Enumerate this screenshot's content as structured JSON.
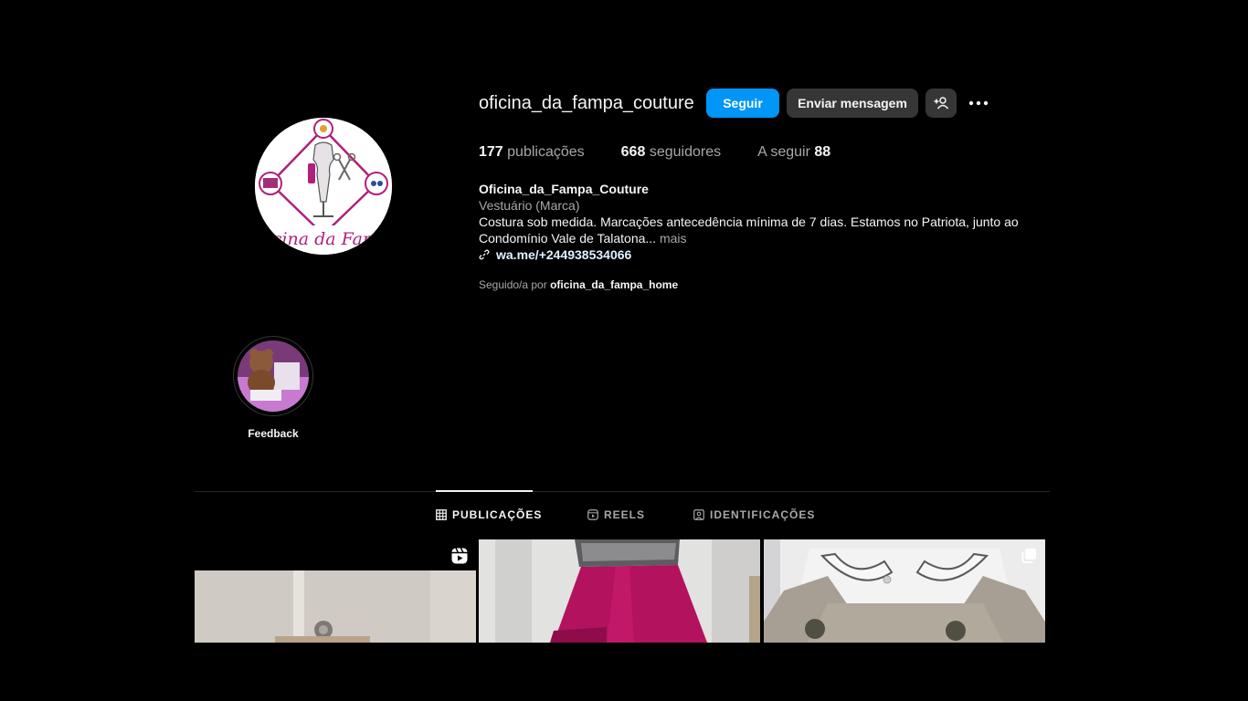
{
  "profile": {
    "username": "oficina_da_fampa_couture",
    "avatar_icon": "profile-logo-oficina",
    "avatar_text": "Oficina da Fampa"
  },
  "actions": {
    "follow_label": "Seguir",
    "message_label": "Enviar mensagem",
    "add_user_icon": "add-user-icon",
    "more_icon": "more-options-icon"
  },
  "stats": {
    "posts_count": "177",
    "posts_label": "publicações",
    "followers_count": "668",
    "followers_label": "seguidores",
    "following_label": "A seguir",
    "following_count": "88"
  },
  "bio": {
    "name": "Oficina_da_Fampa_Couture",
    "category": "Vestuário (Marca)",
    "description": "Costura sob medida. Marcações antecedência mínima de 7 dias. Estamos no Patriota, junto ao Condomínio Vale de Talatona...",
    "more_label": "mais",
    "link_icon": "link-icon",
    "link": "wa.me/+244938534066",
    "followed_by_prefix": "Seguido/a por",
    "followed_by_user": "oficina_da_fampa_home"
  },
  "highlights": [
    {
      "label": "Feedback"
    }
  ],
  "tabs": [
    {
      "label": "PUBLICAÇÕES",
      "icon": "grid-icon",
      "active": true
    },
    {
      "label": "REELS",
      "icon": "reels-icon",
      "active": false
    },
    {
      "label": "IDENTIFICAÇÕES",
      "icon": "tagged-icon",
      "active": false
    }
  ],
  "posts": [
    {
      "type": "reel",
      "overlay_icon": "reels-icon"
    },
    {
      "type": "image",
      "overlay_icon": ""
    },
    {
      "type": "carousel",
      "overlay_icon": "carousel-icon"
    }
  ],
  "colors": {
    "background": "#000000",
    "accent": "#0095f6",
    "secondary_button": "#363636",
    "muted_text": "#a8a8a8",
    "brand_magenta": "#b0207a"
  }
}
